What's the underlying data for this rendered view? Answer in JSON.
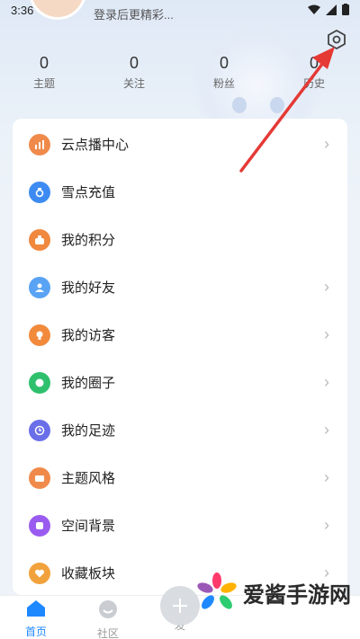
{
  "status_bar": {
    "time": "3:36"
  },
  "header": {
    "login_tip": "登录后更精彩..."
  },
  "stats": [
    {
      "value": "0",
      "label": "主题"
    },
    {
      "value": "0",
      "label": "关注"
    },
    {
      "value": "0",
      "label": "粉丝"
    },
    {
      "value": "0",
      "label": "历史"
    }
  ],
  "menu": [
    {
      "label": "云点播中心",
      "icon": "bar-chart-icon",
      "color": "#f08a4b",
      "chevron": true
    },
    {
      "label": "雪点充值",
      "icon": "diamond-icon",
      "color": "#3d8bf2",
      "chevron": false
    },
    {
      "label": "我的积分",
      "icon": "bag-icon",
      "color": "#f0883e",
      "chevron": false
    },
    {
      "label": "我的好友",
      "icon": "person-icon",
      "color": "#59a3f4",
      "chevron": true
    },
    {
      "label": "我的访客",
      "icon": "bulb-icon",
      "color": "#f28a3c",
      "chevron": true
    },
    {
      "label": "我的圈子",
      "icon": "chat-bubble-icon",
      "color": "#2fc06d",
      "chevron": true
    },
    {
      "label": "我的足迹",
      "icon": "clock-icon",
      "color": "#6a6ee8",
      "chevron": true
    },
    {
      "label": "主题风格",
      "icon": "briefcase-icon",
      "color": "#f08a4b",
      "chevron": true
    },
    {
      "label": "空间背景",
      "icon": "square-icon",
      "color": "#9a5cf0",
      "chevron": true
    },
    {
      "label": "收藏板块",
      "icon": "heart-icon",
      "color": "#f2a23c",
      "chevron": true
    }
  ],
  "tabbar": {
    "home": "首页",
    "community": "社区",
    "post": "发"
  },
  "watermark": {
    "text": "爱酱手游网"
  },
  "colors": {
    "accent": "#1e88ff",
    "arrow": "#e53935"
  }
}
